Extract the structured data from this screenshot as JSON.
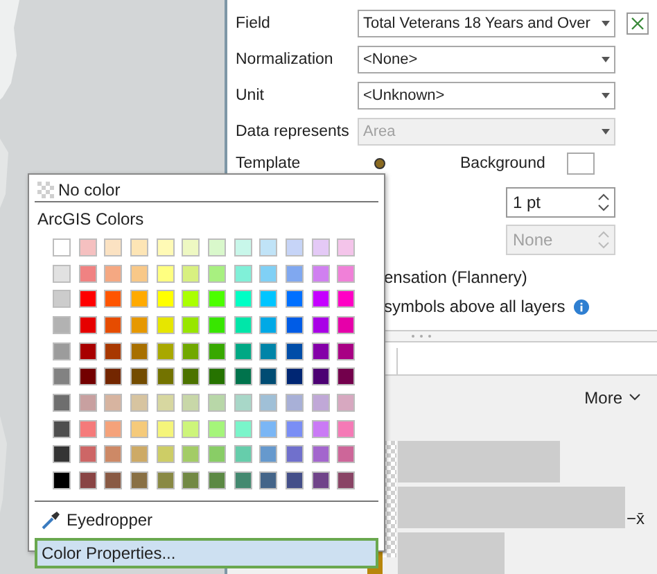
{
  "form_rows": [
    {
      "label": "Field",
      "value": "Total Veterans 18 Years and Over",
      "disabled": false,
      "clear_button": true
    },
    {
      "label": "Normalization",
      "value": "<None>",
      "disabled": false,
      "clear_button": false
    },
    {
      "label": "Unit",
      "value": "<Unknown>",
      "disabled": false,
      "clear_button": false
    },
    {
      "label": "Data represents",
      "value": "Area",
      "disabled": true,
      "clear_button": false
    }
  ],
  "template": {
    "label": "Template",
    "background_label": "Background"
  },
  "spinners": [
    {
      "value": "1 pt",
      "disabled": false
    },
    {
      "value": "None",
      "disabled": true
    }
  ],
  "options": [
    {
      "text": "ensation (Flannery)",
      "info": false
    },
    {
      "text": "symbols above all layers",
      "info": true
    }
  ],
  "histogram": {
    "more_label": "More",
    "mean_label": "−x̄"
  },
  "color_menu": {
    "no_color": "No color",
    "palette_title": "ArcGIS Colors",
    "palette_rows": [
      {
        "swatches": [
          {
            "color": "#ffffff"
          },
          {
            "color": "#f5c0c0"
          },
          {
            "color": "#fbe2c2"
          },
          {
            "color": "#fde5b5"
          },
          {
            "color": "#fffab5"
          },
          {
            "color": "#eef8c2"
          },
          {
            "color": "#d9f8cb"
          },
          {
            "color": "#c8f7ea"
          },
          {
            "color": "#c0e3f7"
          },
          {
            "color": "#c6d4f7"
          },
          {
            "color": "#e4c9f6"
          },
          {
            "color": "#f4c4ea"
          }
        ]
      },
      {
        "swatches": [
          {
            "color": "#e1e1e1"
          },
          {
            "color": "#f08282"
          },
          {
            "color": "#f5a882"
          },
          {
            "color": "#f8c888"
          },
          {
            "color": "#ffff80"
          },
          {
            "color": "#d8f080"
          },
          {
            "color": "#a8f080"
          },
          {
            "color": "#80f0d8"
          },
          {
            "color": "#80d0f5"
          },
          {
            "color": "#80a8f0"
          },
          {
            "color": "#d080f0"
          },
          {
            "color": "#f080d8"
          }
        ]
      },
      {
        "swatches": [
          {
            "color": "#cccccc"
          },
          {
            "color": "#ff0000"
          },
          {
            "color": "#ff5500"
          },
          {
            "color": "#ffaa00"
          },
          {
            "color": "#ffff00"
          },
          {
            "color": "#aaff00"
          },
          {
            "color": "#4cff00"
          },
          {
            "color": "#00ffc5"
          },
          {
            "color": "#00c5ff"
          },
          {
            "color": "#0070ff"
          },
          {
            "color": "#c500ff"
          },
          {
            "color": "#ff00c5"
          }
        ]
      },
      {
        "swatches": [
          {
            "color": "#b2b2b2"
          },
          {
            "color": "#e60000"
          },
          {
            "color": "#e64c00"
          },
          {
            "color": "#e69800"
          },
          {
            "color": "#e6e600"
          },
          {
            "color": "#98e600"
          },
          {
            "color": "#38e600"
          },
          {
            "color": "#00e6a9"
          },
          {
            "color": "#00a9e6"
          },
          {
            "color": "#005ce6"
          },
          {
            "color": "#a900e6"
          },
          {
            "color": "#e600a9"
          }
        ]
      },
      {
        "swatches": [
          {
            "color": "#9c9c9c"
          },
          {
            "color": "#a80000"
          },
          {
            "color": "#a83800"
          },
          {
            "color": "#a87000"
          },
          {
            "color": "#a8a800"
          },
          {
            "color": "#70a800"
          },
          {
            "color": "#38a800"
          },
          {
            "color": "#00a884"
          },
          {
            "color": "#0084a8"
          },
          {
            "color": "#004da8"
          },
          {
            "color": "#8400a8"
          },
          {
            "color": "#a80084"
          }
        ]
      },
      {
        "swatches": [
          {
            "color": "#828282"
          },
          {
            "color": "#730000"
          },
          {
            "color": "#732600"
          },
          {
            "color": "#734c00"
          },
          {
            "color": "#737300"
          },
          {
            "color": "#4c7300"
          },
          {
            "color": "#267300"
          },
          {
            "color": "#00734c"
          },
          {
            "color": "#004c73"
          },
          {
            "color": "#002673"
          },
          {
            "color": "#4c0073"
          },
          {
            "color": "#73004c"
          }
        ]
      },
      {
        "swatches": [
          {
            "color": "#6e6e6e"
          },
          {
            "color": "#c8a0a0"
          },
          {
            "color": "#d7b4a0"
          },
          {
            "color": "#d7c4a0"
          },
          {
            "color": "#d7d7a0"
          },
          {
            "color": "#c8d7a8"
          },
          {
            "color": "#b8d7a8"
          },
          {
            "color": "#a8d7c8"
          },
          {
            "color": "#a0c0d7"
          },
          {
            "color": "#a8b0d7"
          },
          {
            "color": "#c0a8d7"
          },
          {
            "color": "#d7a8c0"
          }
        ]
      },
      {
        "swatches": [
          {
            "color": "#4e4e4e"
          },
          {
            "color": "#f57a7a"
          },
          {
            "color": "#f5a27a"
          },
          {
            "color": "#f5ca7a"
          },
          {
            "color": "#f5f57a"
          },
          {
            "color": "#cdf57a"
          },
          {
            "color": "#a5f57a"
          },
          {
            "color": "#7af5ca"
          },
          {
            "color": "#7ab6f5"
          },
          {
            "color": "#7a8ef5"
          },
          {
            "color": "#ca7af5"
          },
          {
            "color": "#f57ab6"
          }
        ]
      },
      {
        "swatches": [
          {
            "color": "#343434"
          },
          {
            "color": "#cd6666"
          },
          {
            "color": "#cd8966"
          },
          {
            "color": "#cdaa66"
          },
          {
            "color": "#cdcd66"
          },
          {
            "color": "#a3cc66"
          },
          {
            "color": "#89cd66"
          },
          {
            "color": "#66cdab"
          },
          {
            "color": "#6699cd"
          },
          {
            "color": "#7070cc"
          },
          {
            "color": "#a366cd"
          },
          {
            "color": "#cd6699"
          }
        ]
      },
      {
        "swatches": [
          {
            "color": "#000000"
          },
          {
            "color": "#894444"
          },
          {
            "color": "#895a44"
          },
          {
            "color": "#897044"
          },
          {
            "color": "#898944"
          },
          {
            "color": "#728944"
          },
          {
            "color": "#5c8944"
          },
          {
            "color": "#448970"
          },
          {
            "color": "#446589"
          },
          {
            "color": "#444f89"
          },
          {
            "color": "#704489"
          },
          {
            "color": "#894465"
          }
        ]
      }
    ],
    "actions": [
      {
        "kind": "eyedropper",
        "label": "Eyedropper",
        "selected": false
      },
      {
        "kind": "properties",
        "label": "Color Properties...",
        "selected": true
      }
    ]
  }
}
